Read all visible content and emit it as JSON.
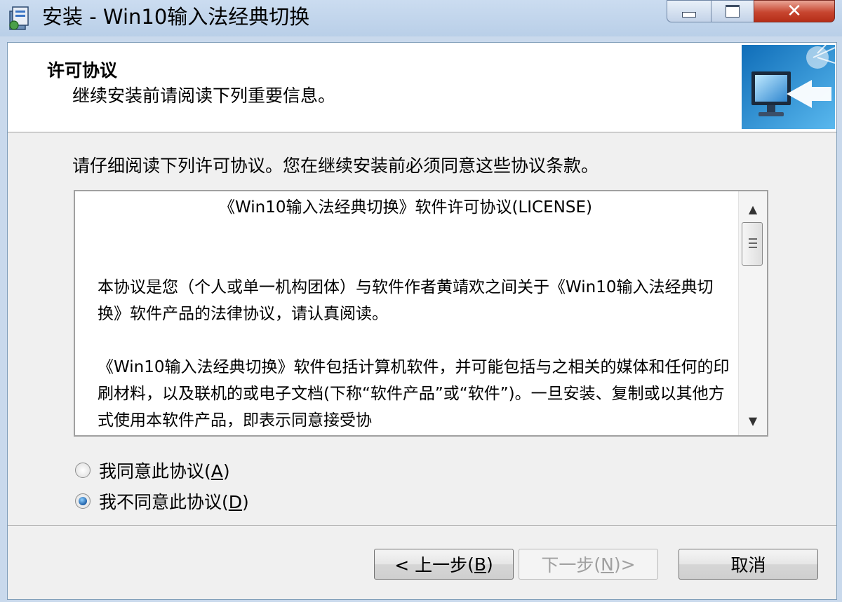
{
  "window": {
    "title": "安装 - Win10输入法经典切换"
  },
  "header": {
    "title": "许可协议",
    "subtitle": "继续安装前请阅读下列重要信息。"
  },
  "main": {
    "instruction": "请仔细阅读下列许可协议。您在继续安装前必须同意这些协议条款。",
    "license": {
      "heading": "《Win10输入法经典切换》软件许可协议(LICENSE)",
      "paragraph1": "本协议是您（个人或单一机构团体）与软件作者黄靖欢之间关于《Win10输入法经典切换》软件产品的法律协议，请认真阅读。",
      "paragraph2": "《Win10输入法经典切换》软件包括计算机软件，并可能包括与之相关的媒体和任何的印刷材料，以及联机的或电子文档(下称“软件产品”或“软件”)。一旦安装、复制或以其他方式使用本软件产品，即表示同意接受协"
    },
    "options": {
      "accept": {
        "text": "我同意此协议",
        "key": "A",
        "selected": false
      },
      "decline": {
        "text": "我不同意此协议",
        "key": "D",
        "selected": true
      }
    }
  },
  "footer": {
    "back": {
      "prefix": "< 上一步",
      "key": "B"
    },
    "next": {
      "prefix": "下一步",
      "key": "N",
      "suffix": " >",
      "enabled": false
    },
    "cancel": "取消"
  },
  "colors": {
    "titlebar": "#c3d6ee",
    "close_button": "#c7452f",
    "dialog_background": "#f0f0f0"
  }
}
